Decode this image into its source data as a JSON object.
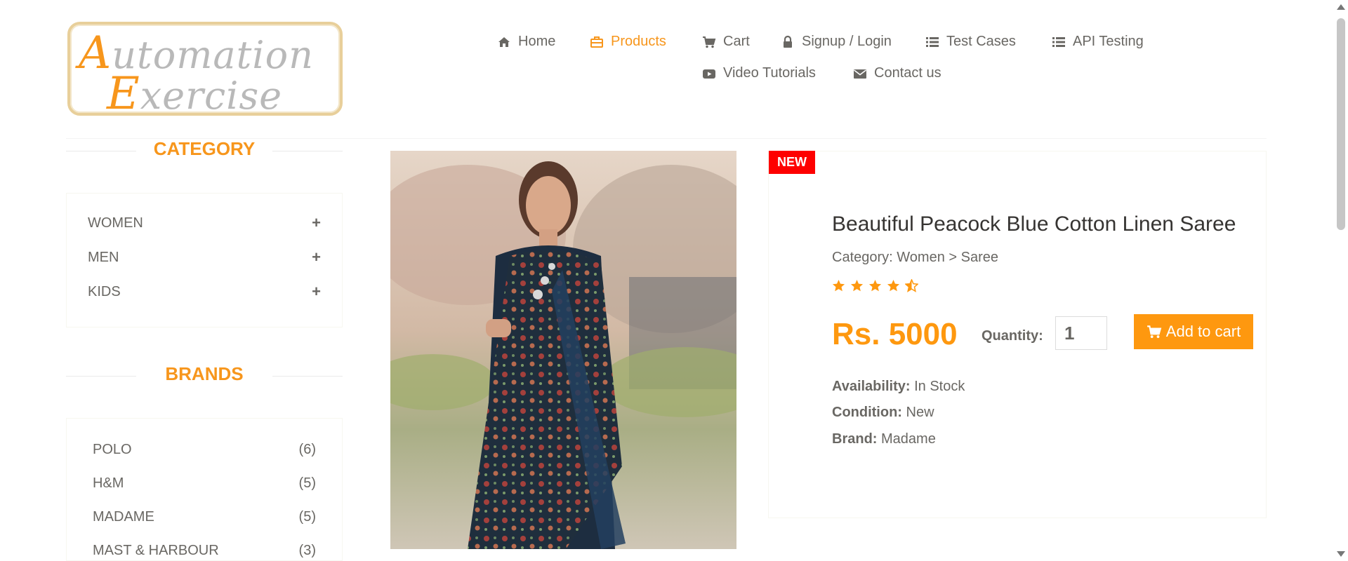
{
  "logo": {
    "line1_cap": "A",
    "line1_rest": "utomation",
    "line2_cap": "E",
    "line2_rest": "xercise"
  },
  "nav": {
    "items": [
      {
        "label": "Home",
        "icon": "home-icon"
      },
      {
        "label": "Products",
        "icon": "products-icon"
      },
      {
        "label": "Cart",
        "icon": "cart-icon"
      },
      {
        "label": "Signup / Login",
        "icon": "lock-icon"
      },
      {
        "label": "Test Cases",
        "icon": "list-icon"
      },
      {
        "label": "API Testing",
        "icon": "list-icon"
      },
      {
        "label": "Video Tutorials",
        "icon": "youtube-icon"
      },
      {
        "label": "Contact us",
        "icon": "envelope-icon"
      }
    ],
    "active": "Products"
  },
  "sidebar": {
    "category_title": "CATEGORY",
    "categories": [
      "WOMEN",
      "MEN",
      "KIDS"
    ],
    "plus_symbol": "+",
    "brands_title": "BRANDS",
    "brands": [
      {
        "name": "POLO",
        "count": "(6)"
      },
      {
        "name": "H&M",
        "count": "(5)"
      },
      {
        "name": "MADAME",
        "count": "(5)"
      },
      {
        "name": "MAST & HARBOUR",
        "count": "(3)"
      }
    ]
  },
  "product": {
    "badge": "NEW",
    "name": "Beautiful Peacock Blue Cotton Linen Saree",
    "category": "Category: Women > Saree",
    "rating": 4.5,
    "price": "Rs. 5000",
    "quantity_label": "Quantity:",
    "quantity_value": "1",
    "add_to_cart": "Add to cart",
    "availability_label": "Availability:",
    "availability_value": "In Stock",
    "condition_label": "Condition:",
    "condition_value": "New",
    "brand_label": "Brand:",
    "brand_value": "Madame"
  },
  "colors": {
    "accent": "#fe980f",
    "badge_red": "#fe0000",
    "text": "#696763"
  }
}
